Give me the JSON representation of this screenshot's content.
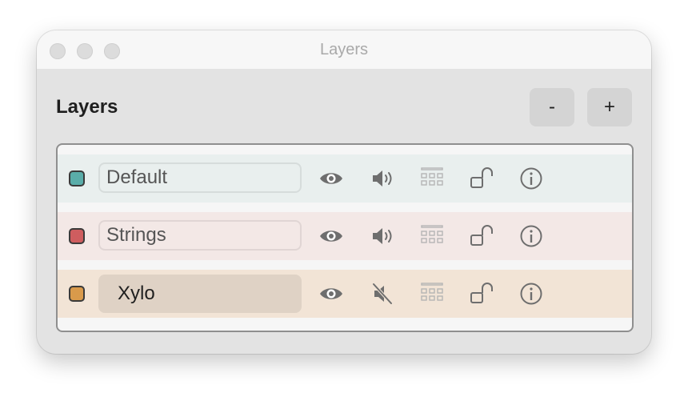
{
  "window": {
    "title": "Layers"
  },
  "panel": {
    "title": "Layers",
    "remove_label": "-",
    "add_label": "+"
  },
  "layers": [
    {
      "name": "Default",
      "color": "#5aada9",
      "row_bg": "#e9efee",
      "visible": true,
      "muted": false,
      "locked": false
    },
    {
      "name": "Strings",
      "color": "#cf5d5f",
      "row_bg": "#f3e8e6",
      "visible": true,
      "muted": false,
      "locked": false
    },
    {
      "name": "Xylo",
      "color": "#d99a4b",
      "row_bg": "#f2e4d6",
      "visible": true,
      "muted": true,
      "locked": false,
      "selected": true
    }
  ],
  "icons": {
    "visibility": "eye-icon",
    "audio": "speaker-icon",
    "audio_muted": "speaker-muted-icon",
    "grid": "grid-icon",
    "lock": "unlocked-icon",
    "info": "info-icon"
  }
}
